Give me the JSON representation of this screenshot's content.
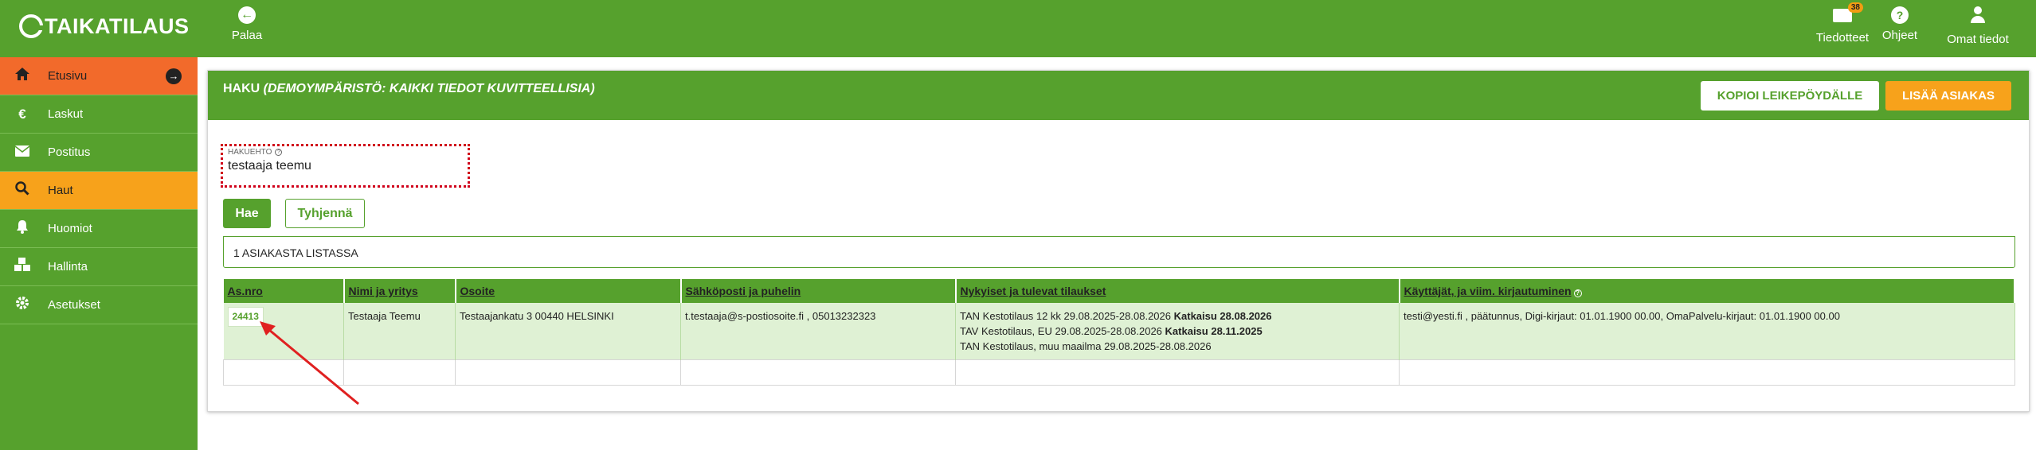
{
  "app": {
    "logo": "TAIKATILAUS"
  },
  "topbar": {
    "back_label": "Palaa",
    "notifications_label": "Tiedotteet",
    "notifications_count": "38",
    "help_label": "Ohjeet",
    "profile_label": "Omat tiedot"
  },
  "sidebar": {
    "items": [
      {
        "label": "Etusivu"
      },
      {
        "label": "Laskut"
      },
      {
        "label": "Postitus"
      },
      {
        "label": "Haut"
      },
      {
        "label": "Huomiot"
      },
      {
        "label": "Hallinta"
      },
      {
        "label": "Asetukset"
      }
    ]
  },
  "panel": {
    "title": "HAKU",
    "title_suffix": "(DEMOYMPÄRISTÖ: KAIKKI TIEDOT KUVITTEELLISIA)",
    "copy_button": "KOPIOI LEIKEPÖYDÄLLE",
    "add_button": "LISÄÄ ASIAKAS"
  },
  "search": {
    "label": "HAKUEHTO",
    "value": "testaaja teemu",
    "search_button": "Hae",
    "clear_button": "Tyhjennä"
  },
  "results": {
    "summary": "1 ASIAKASTA LISTASSA",
    "columns": [
      "As.nro",
      "Nimi ja yritys",
      "Osoite",
      "Sähköposti ja puhelin",
      "Nykyiset ja tulevat tilaukset",
      "Käyttäjät, ja viim. kirjautuminen"
    ],
    "rows": [
      {
        "as_nro": "24413",
        "name": "Testaaja Teemu",
        "address": "Testaajankatu 3 00440 HELSINKI",
        "contact": "t.testaaja@s-postiosoite.fi , 05013232323",
        "orders": [
          {
            "text": "TAN Kestotilaus 12 kk 29.08.2025-28.08.2026",
            "bold": "Katkaisu 28.08.2026"
          },
          {
            "text": "TAV Kestotilaus, EU 29.08.2025-28.08.2026",
            "bold": "Katkaisu 28.11.2025"
          },
          {
            "text": "TAN Kestotilaus, muu maailma 29.08.2025-28.08.2026",
            "bold": ""
          }
        ],
        "users": "testi@yesti.fi , päätunnus, Digi-kirjaut: 01.01.1900 00.00, OmaPalvelu-kirjaut: 01.01.1900 00.00"
      }
    ]
  },
  "colors": {
    "green": "#56a12d",
    "orange": "#f7a21b",
    "home_orange": "#f26a2b",
    "highlight_red": "#d0021b"
  }
}
